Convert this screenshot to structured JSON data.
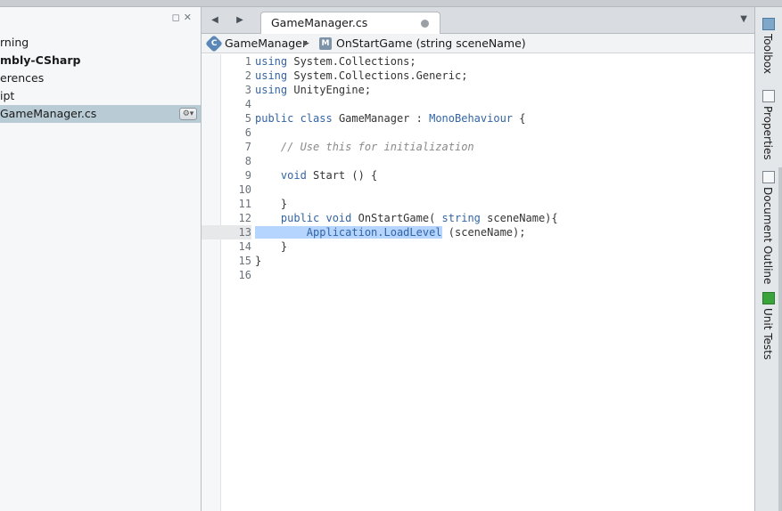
{
  "solution": {
    "items": [
      {
        "label": "rning",
        "bold": false
      },
      {
        "label": "mbly-CSharp",
        "bold": true
      },
      {
        "label": "erences",
        "bold": false
      },
      {
        "label": "ipt",
        "bold": false
      },
      {
        "label": "GameManager.cs",
        "bold": false,
        "selected": true
      }
    ],
    "pad_icon": "restore-icon",
    "close_icon": "close-icon",
    "gear_icon": "gear-icon"
  },
  "tabs": {
    "back_icon": "back-arrow-icon",
    "forward_icon": "forward-arrow-icon",
    "active_tab": "GameManager.cs",
    "menu_icon": "dropdown-arrow-icon"
  },
  "breadcrumb": {
    "class_name": "GameManager",
    "class_icon": "C",
    "method_icon": "M",
    "method_name": "OnStartGame (string sceneName)"
  },
  "code": {
    "current_line": 13,
    "lines": [
      {
        "n": "1",
        "parts": [
          [
            "kw",
            "using"
          ],
          [
            "",
            "System.Collections;"
          ]
        ]
      },
      {
        "n": "2",
        "parts": [
          [
            "kw",
            "using"
          ],
          [
            "",
            "System.Collections.Generic;"
          ]
        ]
      },
      {
        "n": "3",
        "parts": [
          [
            "kw",
            "using"
          ],
          [
            "",
            "UnityEngine;"
          ]
        ]
      },
      {
        "n": "4",
        "parts": []
      },
      {
        "n": "5",
        "parts": [
          [
            "kw",
            "public class"
          ],
          [
            "",
            "GameManager :"
          ],
          [
            "tp",
            "MonoBehaviour"
          ],
          [
            "",
            "{"
          ]
        ]
      },
      {
        "n": "6",
        "parts": []
      },
      {
        "n": "7",
        "parts": [
          [
            "cm",
            "    // Use this for initialization"
          ]
        ]
      },
      {
        "n": "8",
        "parts": []
      },
      {
        "n": "9",
        "parts": [
          [
            "kw",
            "    void"
          ],
          [
            "",
            "Start () {"
          ]
        ]
      },
      {
        "n": "10",
        "parts": []
      },
      {
        "n": "11",
        "parts": [
          [
            "",
            "    }"
          ]
        ]
      },
      {
        "n": "12",
        "parts": [
          [
            "kw",
            "    public void"
          ],
          [
            "",
            "OnStartGame("
          ],
          [
            "kw",
            "string"
          ],
          [
            "",
            "sceneName){"
          ]
        ]
      },
      {
        "n": "13",
        "parts": [
          [
            "hl",
            "    "
          ],
          [
            "hltp",
            "    Application.LoadLevel"
          ],
          [
            "",
            "(sceneName);"
          ]
        ]
      },
      {
        "n": "14",
        "parts": [
          [
            "",
            "    }"
          ]
        ]
      },
      {
        "n": "15",
        "parts": [
          [
            "",
            "}"
          ]
        ]
      },
      {
        "n": "16",
        "parts": []
      }
    ]
  },
  "dock": {
    "items": [
      {
        "label": "Toolbox",
        "icon": "toolbox-icon"
      },
      {
        "label": "Properties",
        "icon": "properties-icon"
      },
      {
        "label": "Document Outline",
        "icon": "document-outline-icon"
      },
      {
        "label": "Unit Tests",
        "icon": "unit-tests-icon"
      }
    ]
  }
}
